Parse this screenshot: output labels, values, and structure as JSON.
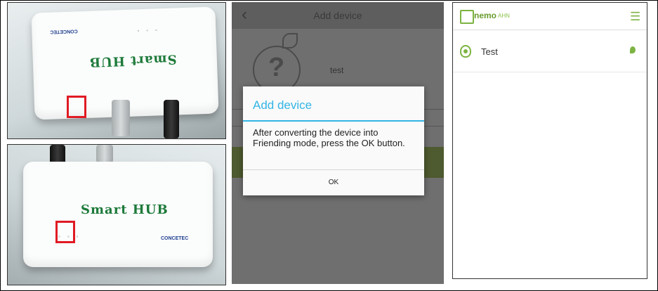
{
  "photo_top": {
    "brand": "CONCETEC",
    "hub_label": "Smart HUB"
  },
  "photo_bottom": {
    "brand": "CONCETEC",
    "hub_label": "Smart HUB"
  },
  "add_device_screen": {
    "title": "Add device",
    "device_name": "test",
    "dialog": {
      "title": "Add device",
      "message": "After converting the device into Friending mode, press the OK button.",
      "ok_label": "OK"
    }
  },
  "app_screen": {
    "logo_text": "nemo",
    "logo_suffix": "AHN",
    "device_list": [
      {
        "label": "Test"
      }
    ]
  },
  "colors": {
    "accent_blue": "#33b5e5",
    "accent_green": "#7cb342",
    "highlight_red": "#e01b24"
  }
}
